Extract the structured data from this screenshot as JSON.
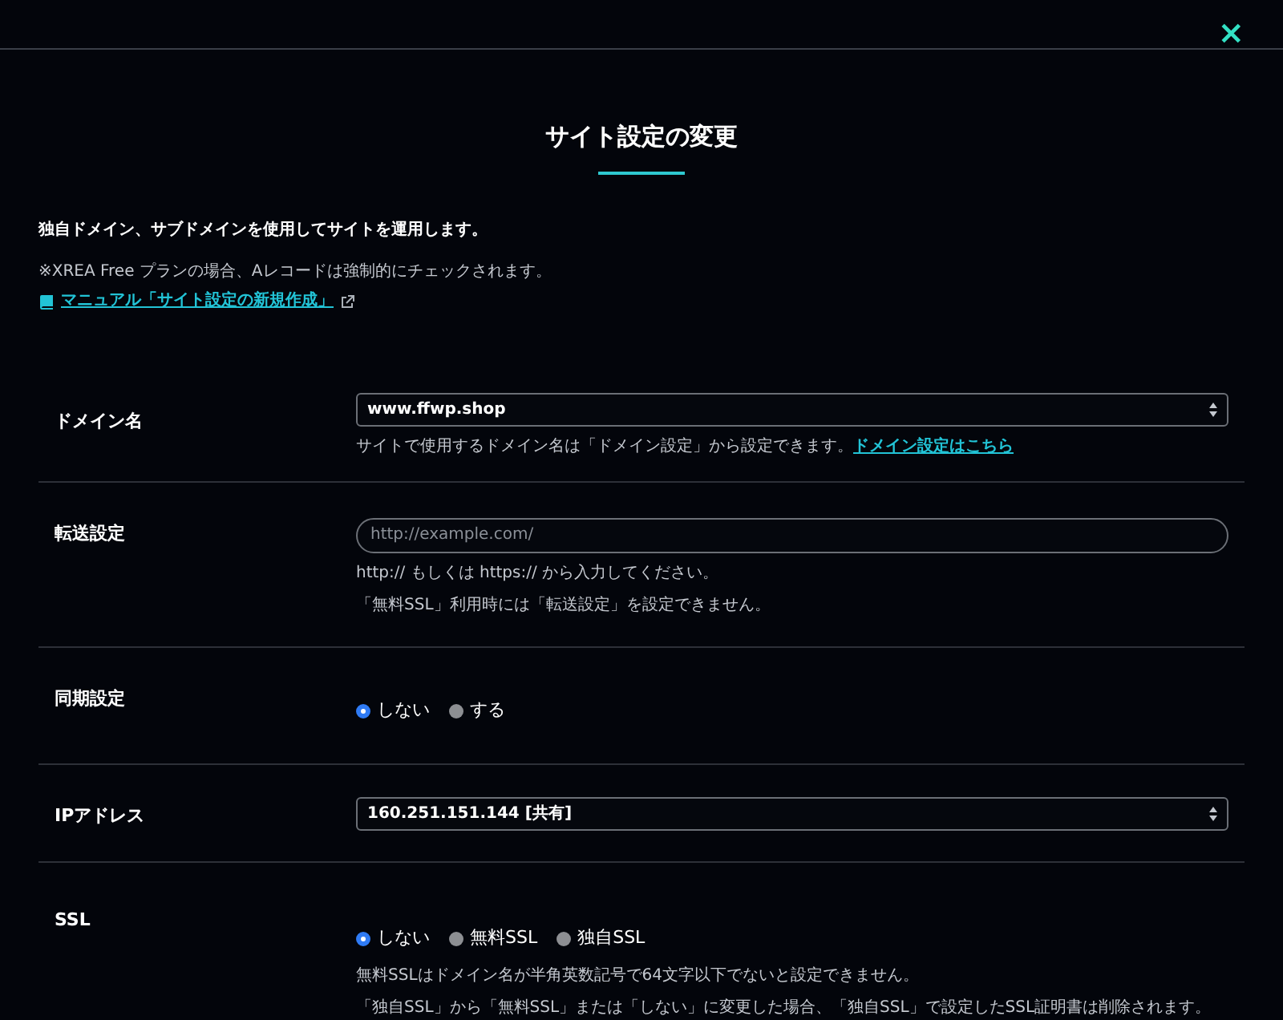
{
  "close_button": {
    "label": "×"
  },
  "title": "サイト設定の変更",
  "intro": {
    "lead": "独自ドメイン、サブドメインを使用してサイトを運用します。",
    "note": "※XREA Free プランの場合、Aレコードは強制的にチェックされます。",
    "manual_link": "マニュアル「サイト設定の新規作成」"
  },
  "fields": [
    {
      "kind": "select",
      "label": "ドメイン名",
      "value": "www.ffwp.shop",
      "help": [
        {
          "text": "サイトで使用するドメイン名は「ドメイン設定」から設定できます。",
          "link": "ドメイン設定はこちら"
        }
      ]
    },
    {
      "kind": "text",
      "label": "転送設定",
      "placeholder": "http://example.com/",
      "help": [
        {
          "text": "http:// もしくは https:// から入力してください。"
        },
        {
          "text": "「無料SSL」利用時には「転送設定」を設定できません。"
        }
      ]
    },
    {
      "kind": "radio",
      "label": "同期設定",
      "options": [
        {
          "label": "しない",
          "selected": true
        },
        {
          "label": "する",
          "selected": false
        }
      ]
    },
    {
      "kind": "select",
      "label": "IPアドレス",
      "value": "160.251.151.144 [共有]"
    },
    {
      "kind": "radio",
      "label": "SSL",
      "options": [
        {
          "label": "しない",
          "selected": true
        },
        {
          "label": "無料SSL",
          "selected": false
        },
        {
          "label": "独自SSL",
          "selected": false
        }
      ],
      "help": [
        {
          "text": "無料SSLはドメイン名が半角英数記号で64文字以下でないと設定できません。"
        },
        {
          "text": "「独自SSL」から「無料SSL」または「しない」に変更した場合、「独自SSL」で設定したSSL証明書は削除されます。"
        }
      ]
    }
  ]
}
